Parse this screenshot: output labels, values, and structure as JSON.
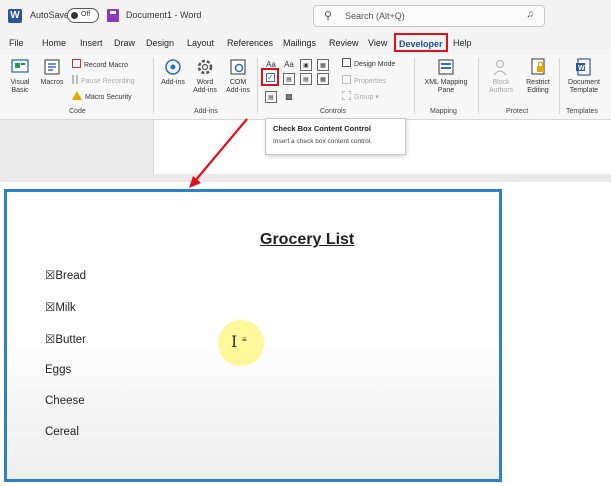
{
  "titlebar": {
    "autosave_label": "AutoSave",
    "autosave_state": "Off",
    "doc_title": "Document1 - Word",
    "search_placeholder": "Search (Alt+Q)"
  },
  "tabs": [
    "File",
    "Home",
    "Insert",
    "Draw",
    "Design",
    "Layout",
    "References",
    "Mailings",
    "Review",
    "View",
    "Developer",
    "Help"
  ],
  "active_tab": "Developer",
  "ribbon": {
    "code": {
      "label": "Code",
      "visual_basic": "Visual Basic",
      "macros": "Macros",
      "record_macro": "Record Macro",
      "pause_recording": "Pause Recording",
      "macro_security": "Macro Security"
    },
    "addins": {
      "label": "Add-ins",
      "add_ins": "Add-ins",
      "word_add_ins": "Word Add-ins",
      "com_add_ins": "COM Add-ins"
    },
    "controls": {
      "label": "Controls",
      "design_mode": "Design Mode",
      "properties": "Properties",
      "group": "Group"
    },
    "mapping": {
      "label": "Mapping",
      "xml_mapping_pane": "XML Mapping Pane"
    },
    "protect": {
      "label": "Protect",
      "block_authors": "Block Authors",
      "restrict_editing": "Restrict Editing"
    },
    "templates": {
      "label": "Templates",
      "document_template": "Document Template"
    }
  },
  "tooltip": {
    "title": "Check Box Content Control",
    "description": "Insert a check box content control."
  },
  "document": {
    "title": "Grocery List",
    "items": [
      {
        "text": "Bread",
        "checkbox": "☒"
      },
      {
        "text": "Milk",
        "checkbox": "☒"
      },
      {
        "text": "Butter",
        "checkbox": "☒"
      },
      {
        "text": "Eggs",
        "checkbox": ""
      },
      {
        "text": "Cheese",
        "checkbox": ""
      },
      {
        "text": "Cereal",
        "checkbox": ""
      }
    ]
  },
  "colors": {
    "highlight_red": "#e0101b",
    "frame_blue": "#2d82c6",
    "word_blue": "#2b579a"
  }
}
